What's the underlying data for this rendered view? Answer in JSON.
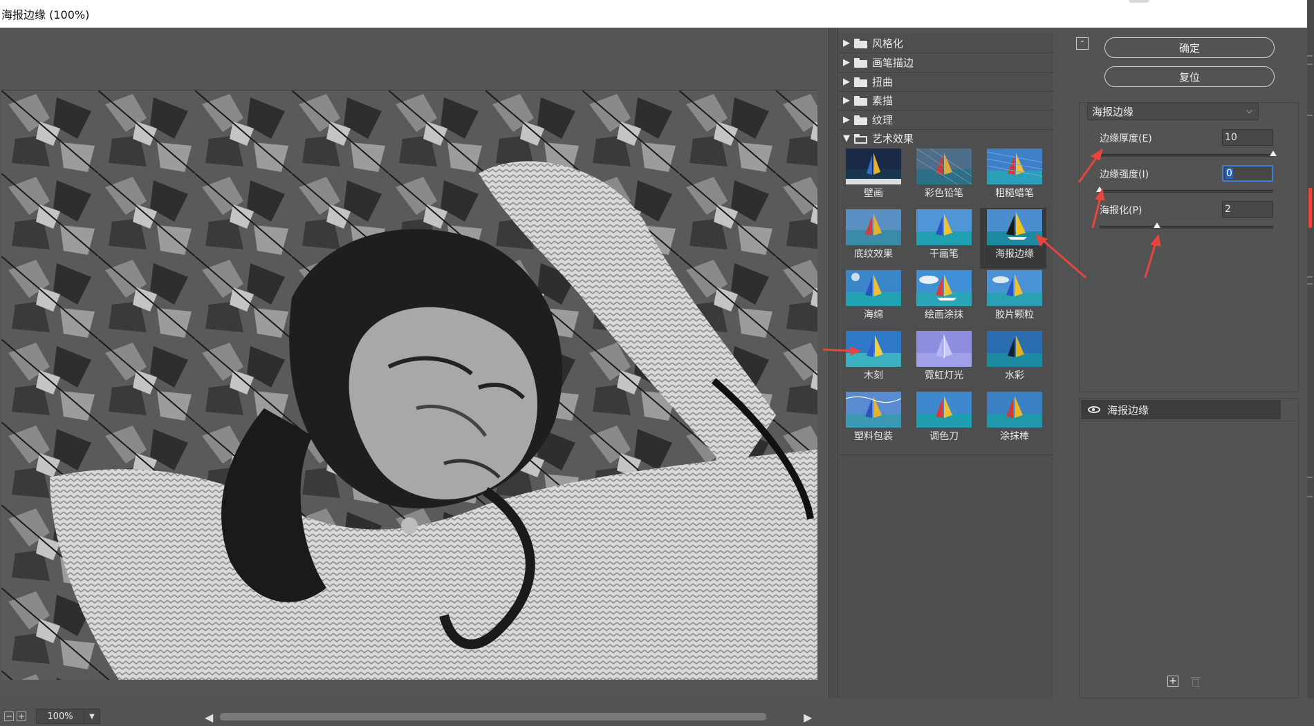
{
  "window": {
    "title": "海报边缘 (100%)"
  },
  "preview": {
    "zoom": "100%",
    "zoom_out_icon": "minus-square-icon",
    "zoom_in_icon": "plus-square-icon"
  },
  "gallery": {
    "categories": [
      {
        "label": "风格化",
        "expanded": false
      },
      {
        "label": "画笔描边",
        "expanded": false
      },
      {
        "label": "扭曲",
        "expanded": false
      },
      {
        "label": "素描",
        "expanded": false
      },
      {
        "label": "纹理",
        "expanded": false
      },
      {
        "label": "艺术效果",
        "expanded": true
      }
    ],
    "filters": [
      {
        "label": "壁画"
      },
      {
        "label": "彩色铅笔"
      },
      {
        "label": "粗糙蜡笔"
      },
      {
        "label": "底纹效果"
      },
      {
        "label": "干画笔"
      },
      {
        "label": "海报边缘",
        "selected": true
      },
      {
        "label": "海绵"
      },
      {
        "label": "绘画涂抹"
      },
      {
        "label": "胶片颗粒"
      },
      {
        "label": "木刻"
      },
      {
        "label": "霓虹灯光"
      },
      {
        "label": "水彩"
      },
      {
        "label": "塑料包装"
      },
      {
        "label": "调色刀"
      },
      {
        "label": "涂抹棒"
      }
    ]
  },
  "panel": {
    "ok_label": "确定",
    "reset_label": "复位",
    "filter_select": "海报边缘",
    "params": [
      {
        "label": "边缘厚度(E)",
        "value": "10",
        "level": 1.0
      },
      {
        "label": "边缘强度(I)",
        "value": "0",
        "level": 0.0,
        "focused": true
      },
      {
        "label": "海报化(P)",
        "value": "2",
        "level": 0.33
      }
    ],
    "layer_label": "海报边缘"
  },
  "colors": {
    "background": "#535353",
    "accent_annotation": "#e8453c",
    "focus": "#3d7fd6"
  }
}
